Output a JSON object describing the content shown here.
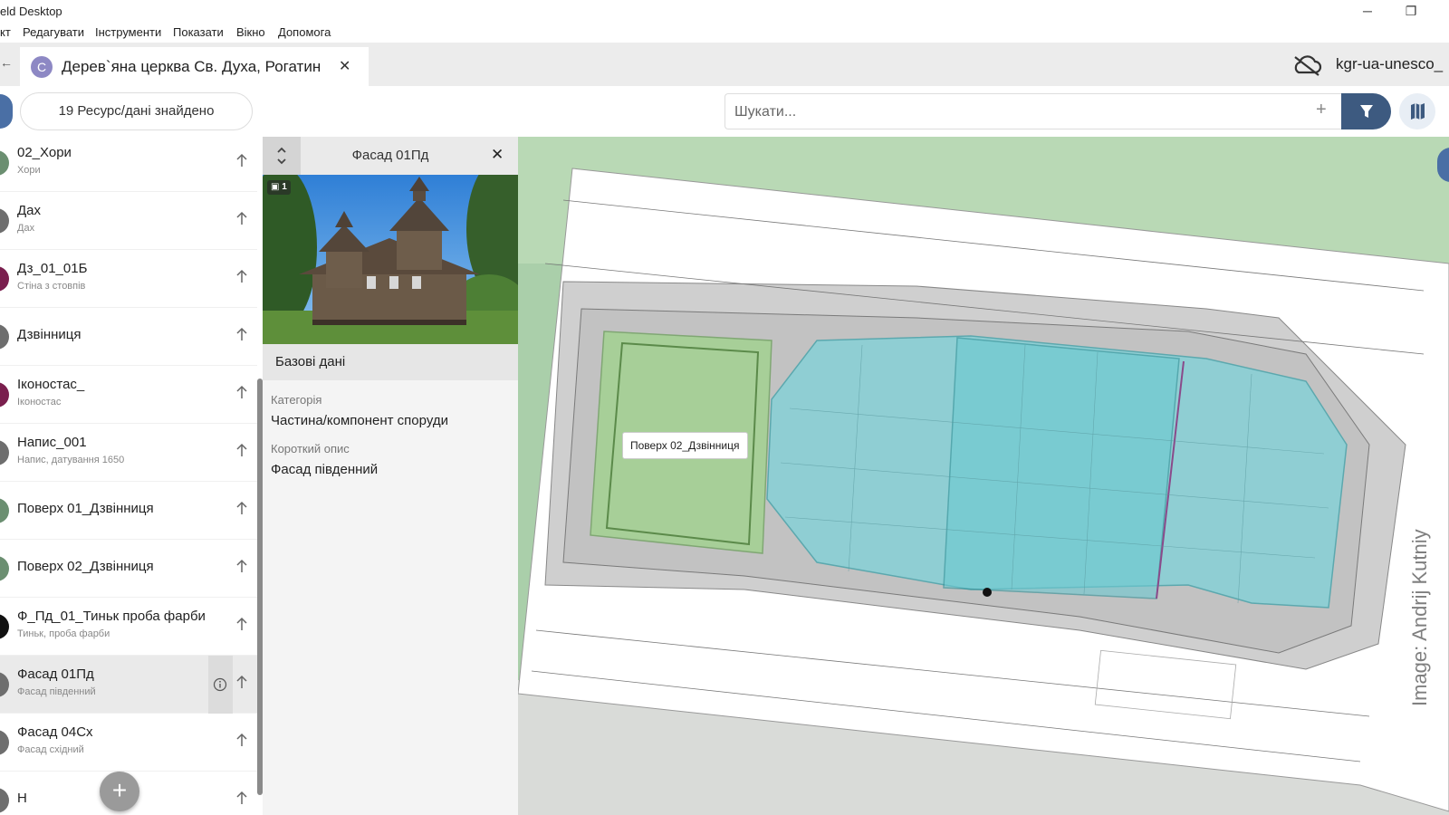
{
  "window": {
    "app_title": "eld Desktop"
  },
  "menu": [
    "кт",
    "Редагувати",
    "Інструменти",
    "Показати",
    "Вікно",
    "Допомога"
  ],
  "tab": {
    "avatar_letter": "C",
    "title": "Дерев`яна церква Св. Духа, Рогатин"
  },
  "project": "kgr-ua-unesco_",
  "toolbar": {
    "count_label": "19 Ресурс/дані знайдено",
    "search_placeholder": "Шукати..."
  },
  "resources": [
    {
      "title": "02_Хори",
      "subtitle": "Хори",
      "color": "#6b8f71"
    },
    {
      "title": "Дах",
      "subtitle": "Дах",
      "color": "#6e6e6e"
    },
    {
      "title": "Дз_01_01Б",
      "subtitle": "Стіна з стовпів",
      "color": "#7a1f4e"
    },
    {
      "title": "Дзвінниця",
      "subtitle": "",
      "color": "#6e6e6e"
    },
    {
      "title": "Іконостас_",
      "subtitle": "Іконостас",
      "color": "#7a1f4e"
    },
    {
      "title": "Напис_001",
      "subtitle": "Напис, датування 1650",
      "color": "#6e6e6e"
    },
    {
      "title": "Поверх 01_Дзвінниця",
      "subtitle": "",
      "color": "#6b8f71"
    },
    {
      "title": "Поверх 02_Дзвінниця",
      "subtitle": "",
      "color": "#6b8f71"
    },
    {
      "title": "Ф_Пд_01_Тиньк проба фарби",
      "subtitle": "Тиньк, проба фарби",
      "color": "#111111"
    },
    {
      "title": "Фасад 01Пд",
      "subtitle": "Фасад південний",
      "color": "#6e6e6e",
      "selected": true
    },
    {
      "title": "Фасад 04Сх",
      "subtitle": "Фасад східний",
      "color": "#6e6e6e"
    },
    {
      "title": "Н",
      "subtitle": "",
      "color": "#6e6e6e"
    }
  ],
  "detail": {
    "title": "Фасад 01Пд",
    "image_count": "1",
    "section": "Базові дані",
    "category_label": "Категорія",
    "category_value": "Частина/компонент споруди",
    "desc_label": "Короткий опис",
    "desc_value": "Фасад південний"
  },
  "map": {
    "tooltip": "Поверх 02_Дзвінниця",
    "credit": "Image: Andrij Kutniy"
  }
}
